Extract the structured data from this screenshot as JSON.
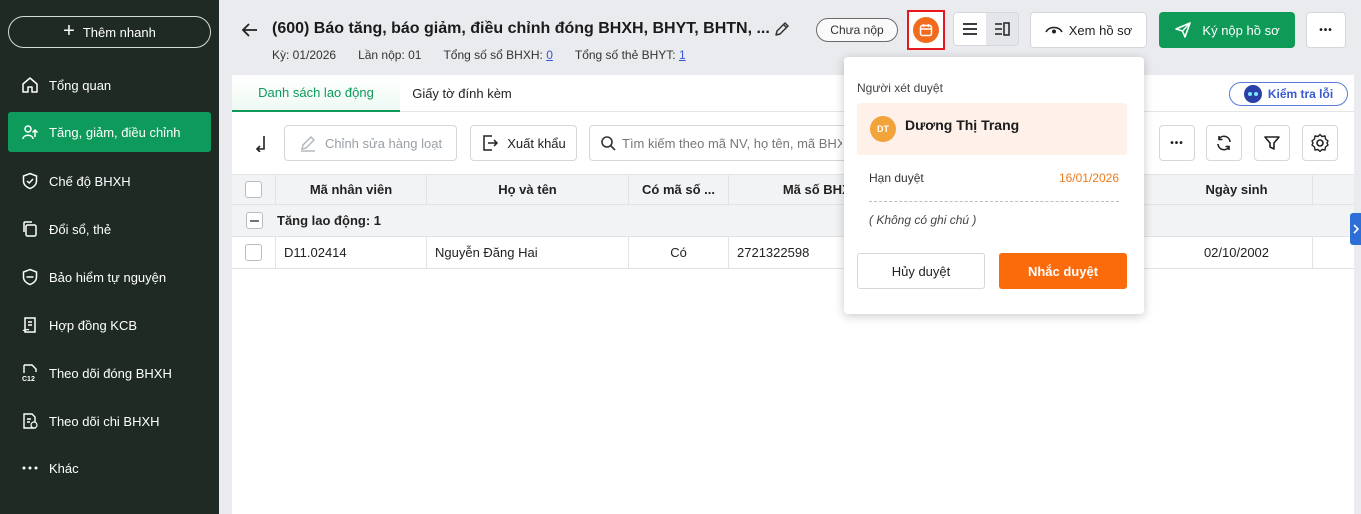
{
  "sidebar": {
    "quick_add_label": "Thêm nhanh",
    "items": [
      {
        "label": "Tổng quan",
        "icon": "home-icon"
      },
      {
        "label": "Tăng, giảm, điều chỉnh",
        "icon": "user-arrow-icon",
        "active": true
      },
      {
        "label": "Chế độ BHXH",
        "icon": "shield-check-icon"
      },
      {
        "label": "Đổi sổ, thẻ",
        "icon": "copy-icon"
      },
      {
        "label": "Bảo hiểm tự nguyện",
        "icon": "shield-icon"
      },
      {
        "label": "Hợp đồng KCB",
        "icon": "contract-icon"
      },
      {
        "label": "Theo dõi đóng BHXH",
        "icon": "document-c12-icon"
      },
      {
        "label": "Theo dõi chi BHXH",
        "icon": "document-dollar-icon"
      },
      {
        "label": "Khác",
        "icon": "more-dots-icon"
      }
    ]
  },
  "header": {
    "title": "(600) Báo tăng, báo giảm, điều chỉnh đóng BHXH, BHYT, BHTN, ...",
    "period": "Kỳ: 01/2026",
    "submission": "Lần nộp: 01",
    "bhxh_count_label": "Tổng số sổ BHXH:",
    "bhxh_count": "0",
    "bhyt_count_label": "Tổng số thẻ BHYT:",
    "bhyt_count": "1",
    "status": "Chưa nộp",
    "view_profile_label": "Xem hồ sơ",
    "sign_submit_label": "Ký nộp hồ sơ",
    "more_label": "•••"
  },
  "tabs": [
    {
      "label": "Danh sách lao động",
      "active": true
    },
    {
      "label": "Giấy tờ đính kèm",
      "active": false
    }
  ],
  "check_error_label": "Kiểm tra lỗi",
  "toolbar": {
    "bulk_edit_label": "Chỉnh sửa hàng loạt",
    "export_label": "Xuất khẩu",
    "search_placeholder": "Tìm kiếm theo mã NV, họ tên, mã BHXH",
    "more_label": "•••"
  },
  "table": {
    "columns": [
      "Mã nhân viên",
      "Họ và tên",
      "Có mã số ...",
      "Mã số BHXH",
      "Ngày sinh"
    ],
    "group_label": "Tăng lao động: 1",
    "rows": [
      {
        "employee_id": "D11.02414",
        "full_name": "Nguyễn Đăng Hai",
        "has_code": "Có",
        "bhxh_code": "2721322598",
        "birth_date": "02/10/2002"
      }
    ]
  },
  "approval_popover": {
    "reviewer_label": "Người xét duyệt",
    "reviewer_initials": "DT",
    "reviewer_name": "Dương Thị Trang",
    "deadline_label": "Hạn duyệt",
    "deadline_value": "16/01/2026",
    "note": "( Không có ghi chú )",
    "cancel_label": "Hủy duyệt",
    "remind_label": "Nhắc duyệt"
  },
  "colors": {
    "sidebar_bg": "#1f2a24",
    "accent_green": "#0e9a5a",
    "accent_orange": "#fb6b0b",
    "highlight_red": "#e8161d"
  }
}
